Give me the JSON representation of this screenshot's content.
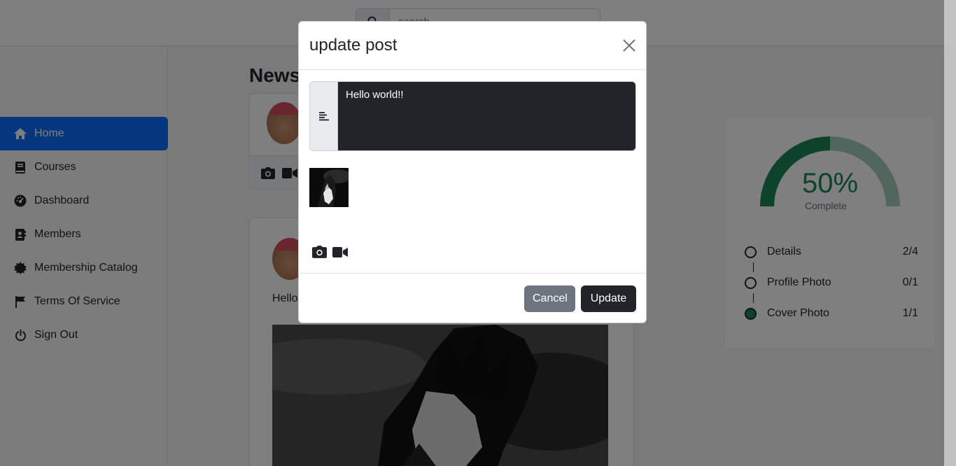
{
  "search": {
    "placeholder": "search"
  },
  "sidebar": {
    "items": [
      {
        "label": "Home",
        "icon": "home-icon",
        "active": true
      },
      {
        "label": "Courses",
        "icon": "book-icon"
      },
      {
        "label": "Dashboard",
        "icon": "gauge-icon"
      },
      {
        "label": "Members",
        "icon": "address-book-icon"
      },
      {
        "label": "Membership Catalog",
        "icon": "certificate-icon"
      },
      {
        "label": "Terms Of Service",
        "icon": "flag-icon"
      },
      {
        "label": "Sign Out",
        "icon": "power-icon"
      }
    ]
  },
  "feed": {
    "title": "News",
    "post": {
      "text": "Hello"
    }
  },
  "profile_progress": {
    "percent_label": "50%",
    "percent": 50,
    "caption": "Complete",
    "steps": [
      {
        "label": "Details",
        "count": "2/4",
        "done": false
      },
      {
        "label": "Profile Photo",
        "count": "0/1",
        "done": false
      },
      {
        "label": "Cover Photo",
        "count": "1/1",
        "done": true
      }
    ]
  },
  "modal": {
    "title": "update post",
    "text_value": "Hello world!!",
    "cancel_label": "Cancel",
    "update_label": "Update"
  },
  "colors": {
    "primary": "#0d6efd",
    "success": "#198754",
    "dark": "#212529",
    "secondary": "#6c757d"
  }
}
